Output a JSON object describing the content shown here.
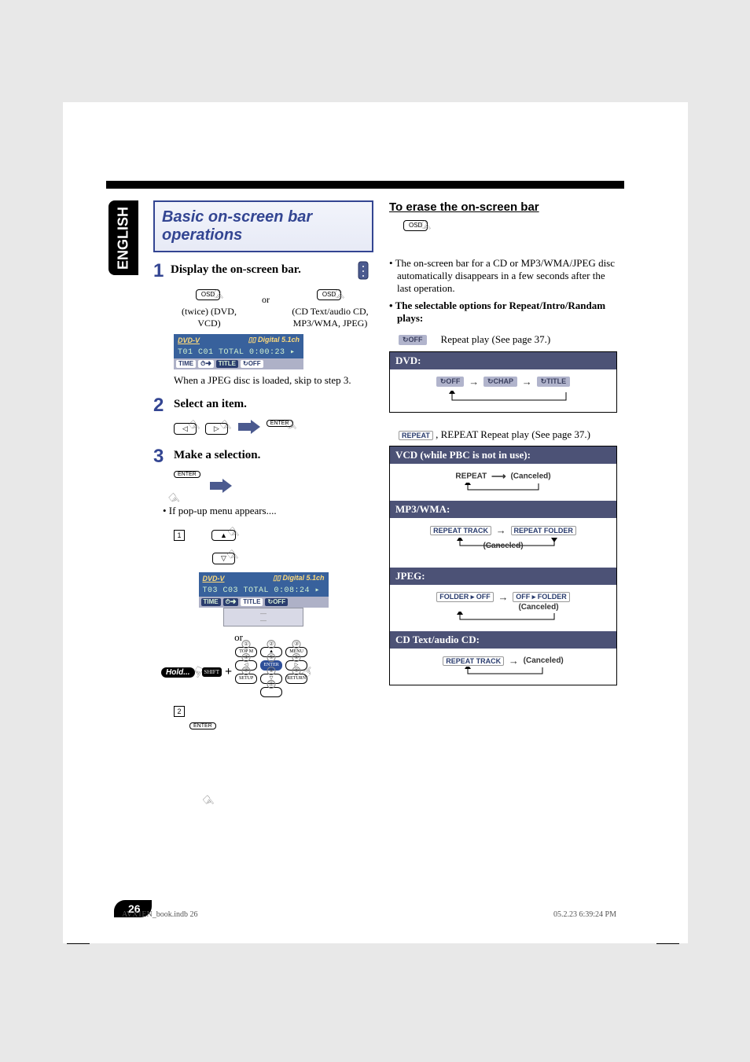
{
  "language_tab": "ENGLISH",
  "title": "Basic on-screen bar operations",
  "steps": {
    "s1": {
      "num": "1",
      "text": "Display the on-screen bar."
    },
    "s2": {
      "num": "2",
      "text": "Select an item."
    },
    "s3": {
      "num": "3",
      "text": "Make a selection."
    }
  },
  "buttons": {
    "osd": "OSD",
    "enter": "ENTER",
    "shift": "SHIFT",
    "hold": "Hold...",
    "topm": "TOP M",
    "menu": "MENU",
    "setup": "SETUP",
    "return": "RETURN",
    "up": "▲",
    "down": "▽",
    "left": "◁",
    "right": "▷"
  },
  "labels": {
    "or": "or",
    "twice": "(twice) (DVD, VCD)",
    "cdtext": "(CD Text/audio CD, MP3/WMA, JPEG)",
    "jpeg_skip": "When a JPEG disc is loaded, skip to step 3.",
    "popup": "•  If pop-up menu appears....",
    "plus": "+"
  },
  "osd_bars": {
    "bar1_row1": "DVD-V",
    "bar1_dolby": "▯▯ Digital 5.1ch",
    "bar1_row2": "T01 C01 TOTAL 0:00:23  ▸",
    "bar2_row1": "DVD-V",
    "bar2_row2": "T03 C03 TOTAL 0:08:24  ▸",
    "chips": {
      "time": "TIME",
      "clock": "⏱➜",
      "title": "TITLE",
      "off": "↻OFF"
    }
  },
  "right": {
    "erase_head": "To erase the on-screen bar",
    "erase_note": "•  The on-screen bar for a CD or MP3/WMA/JPEG disc automatically disappears in a few seconds after the last operation.",
    "select_note": "•  The selectable options for Repeat/Intro/Randam plays:",
    "repeat_off_label": "Repeat play (See page 37.)",
    "repeat_chip_off": "↻OFF",
    "repeat_chip_chap": "↻CHAP",
    "repeat_chip_title": "↻TITLE",
    "repeat_chip": "REPEAT",
    "repeat_text": ", REPEAT",
    "repeat_desc": " Repeat play (See page 37.)",
    "repeat_label": "REPEAT",
    "repeat_track": "REPEAT TRACK",
    "repeat_folder": "REPEAT FOLDER",
    "folder_off": "FOLDER ▸ OFF",
    "off_folder": "OFF ▸ FOLDER",
    "canceled": "(Canceled)",
    "heads": {
      "dvd": "DVD:",
      "vcd": "VCD (while PBC is not in use):",
      "mp3": "MP3/WMA:",
      "jpeg": "JPEG:",
      "cd": "CD Text/audio CD:"
    }
  },
  "page_number": "26",
  "footer": {
    "left": "AVX1EN_book.indb   26",
    "right": "05.2.23   6:39:24 PM"
  },
  "colorbar": {
    "left": [
      "#000000",
      "#3a3a3a",
      "#6d6d6d",
      "#9a9a9a",
      "#c6c6c6",
      "#ffffff",
      "#fff200",
      "#ec008c",
      "#00aeef"
    ],
    "right": [
      "#000000",
      "#3a3a3a",
      "#6d6d6d",
      "#9a9a9a",
      "#c6c6c6",
      "#ffffff",
      "#00a651",
      "#ed1c24",
      "#2e3192"
    ]
  }
}
